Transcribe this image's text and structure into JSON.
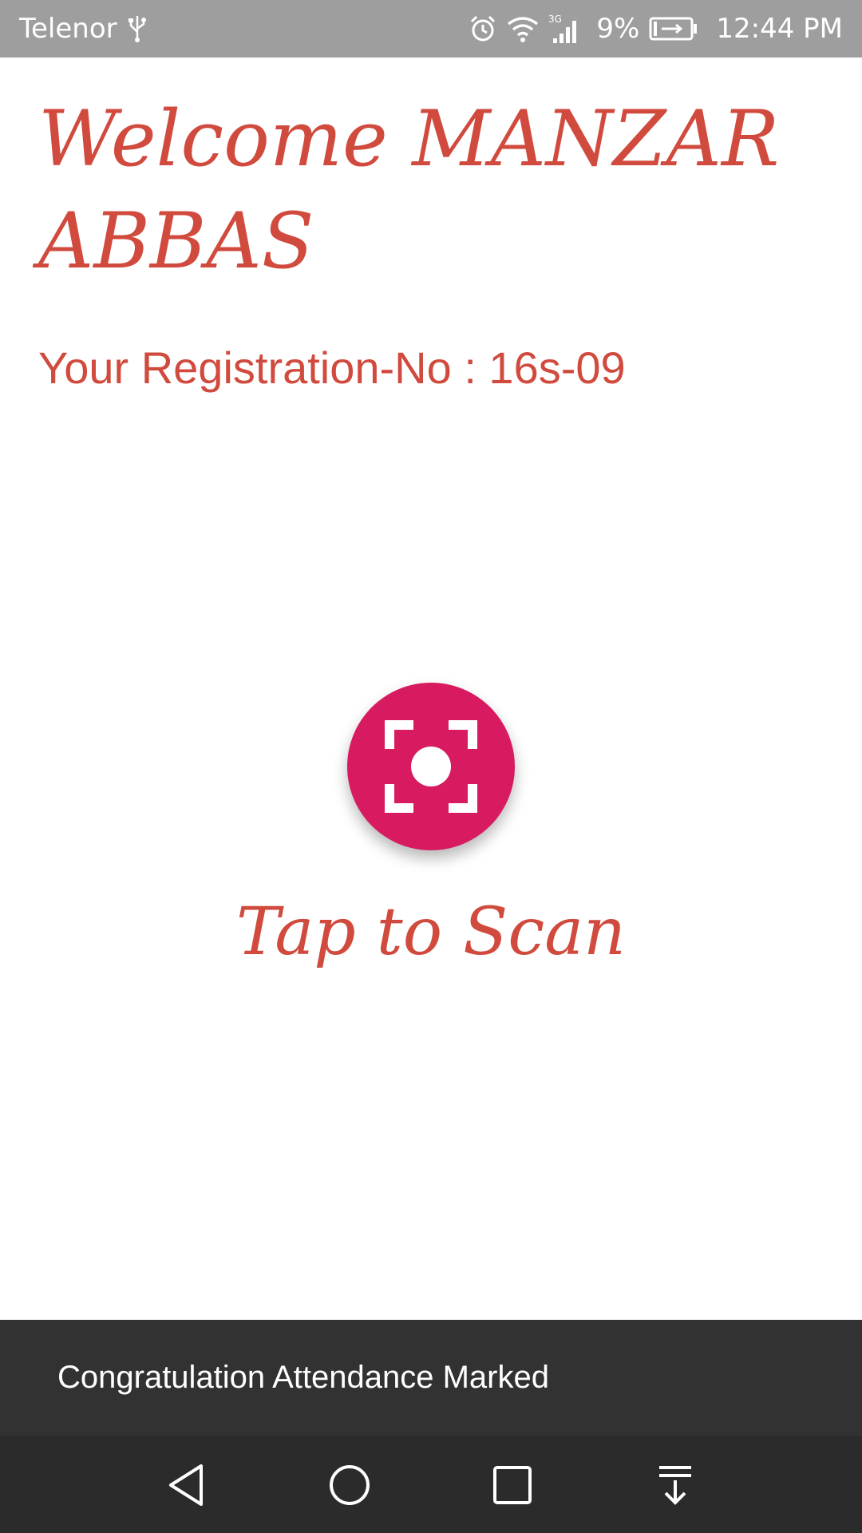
{
  "status_bar": {
    "carrier": "Telenor",
    "network": "3G",
    "battery": "9%",
    "time": "12:44 PM",
    "icons": [
      "usb-icon",
      "alarm-icon",
      "wifi-icon",
      "signal-icon",
      "battery-charging-icon"
    ]
  },
  "main": {
    "welcome": "Welcome MANZAR ABBAS",
    "registration": "Your Registration-No : 16s-09",
    "scan_icon": "scan-icon",
    "tap_label": "Tap to Scan"
  },
  "snackbar": {
    "message": "Congratulation Attendance Marked"
  },
  "nav_bar": {
    "icons": [
      "back-icon",
      "home-icon",
      "recents-icon",
      "notification-pulldown-icon"
    ]
  },
  "colors": {
    "accent_text": "#d14a3e",
    "fab": "#d81b60",
    "snackbar": "#323232",
    "status_bar": "#9e9e9e"
  }
}
